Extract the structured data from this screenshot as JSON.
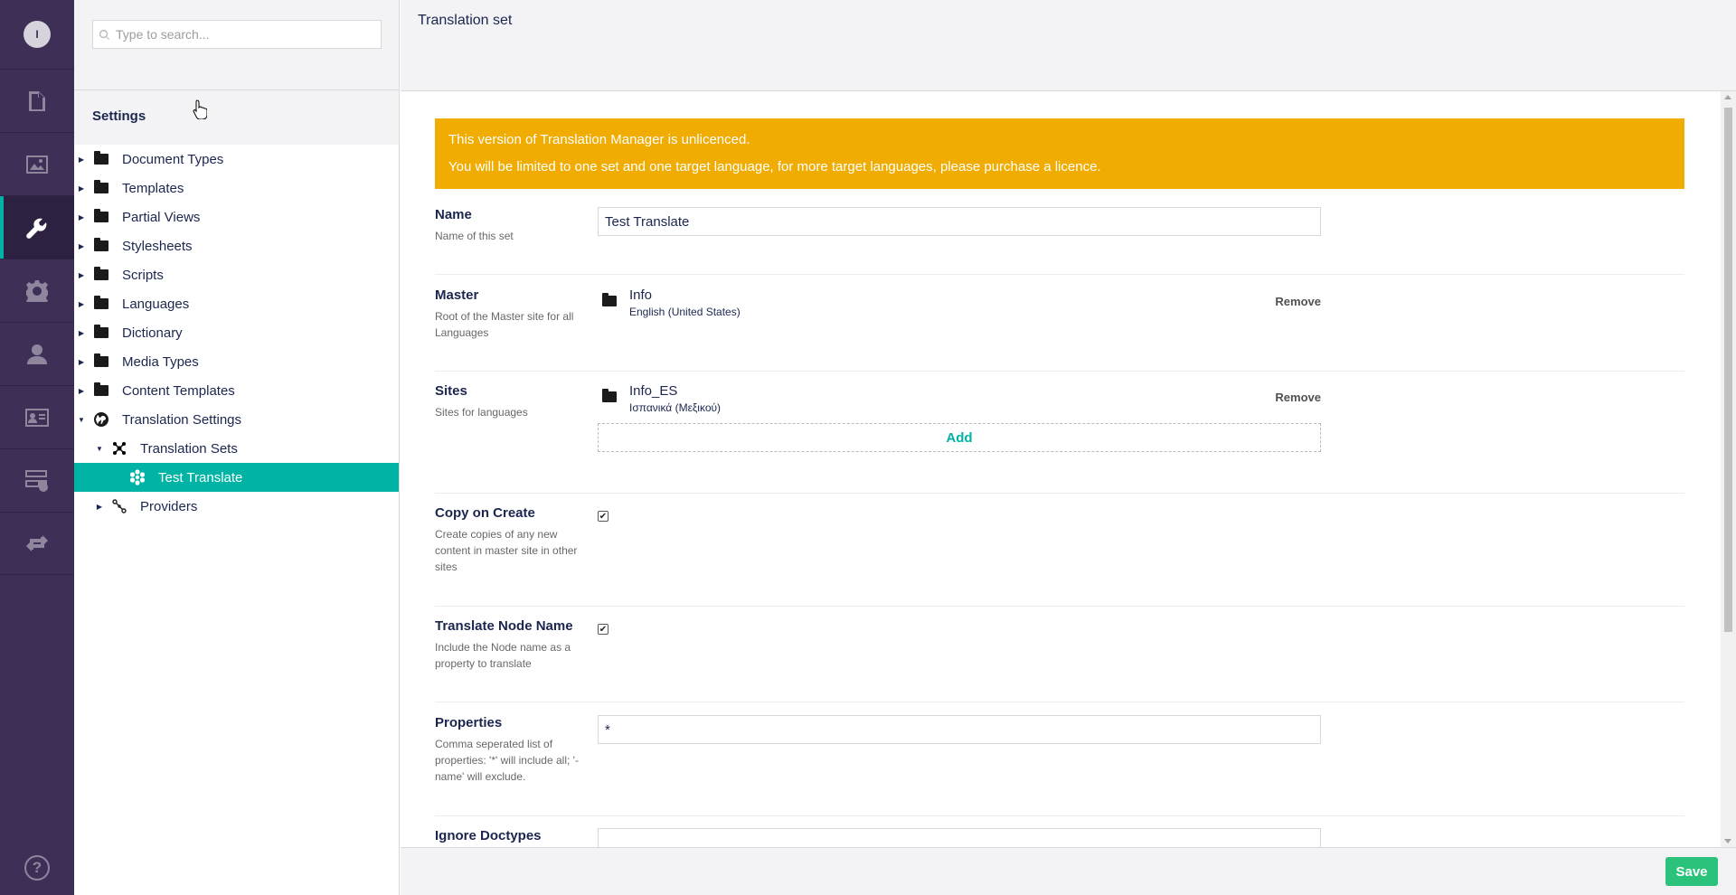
{
  "user": {
    "initial": "I"
  },
  "sections": [
    "content-icon",
    "media-icon",
    "settings-wrench-icon",
    "packages-gear-icon",
    "users-icon",
    "members-icon",
    "forms-icon",
    "translation-icon"
  ],
  "help_label": "?",
  "search": {
    "placeholder": "Type to search..."
  },
  "tree": {
    "title": "Settings",
    "items": [
      {
        "label": "Document Types",
        "icon": "folder-icon"
      },
      {
        "label": "Templates",
        "icon": "folder-icon"
      },
      {
        "label": "Partial Views",
        "icon": "folder-icon"
      },
      {
        "label": "Stylesheets",
        "icon": "folder-icon"
      },
      {
        "label": "Scripts",
        "icon": "folder-icon"
      },
      {
        "label": "Languages",
        "icon": "folder-icon"
      },
      {
        "label": "Dictionary",
        "icon": "folder-icon"
      },
      {
        "label": "Media Types",
        "icon": "folder-icon"
      },
      {
        "label": "Content Templates",
        "icon": "folder-icon"
      },
      {
        "label": "Translation Settings",
        "icon": "globe-icon"
      },
      {
        "label": "Translation Sets",
        "icon": "nodes-icon"
      },
      {
        "label": "Test Translate",
        "icon": "flower-icon"
      },
      {
        "label": "Providers",
        "icon": "link-icon"
      }
    ]
  },
  "editor": {
    "title": "Translation set",
    "notice": {
      "line1": "This version of Translation Manager is unlicenced.",
      "line2": "You will be limited to one set and one target language, for more target languages, please purchase a licence."
    },
    "name": {
      "label": "Name",
      "description": "Name of this set",
      "value": "Test Translate"
    },
    "master": {
      "label": "Master",
      "description": "Root of the Master site for all Languages",
      "node": "Info",
      "culture": "English (United States)",
      "remove": "Remove"
    },
    "sites": {
      "label": "Sites",
      "description": "Sites for languages",
      "node": "Info_ES",
      "culture": "Ισπανικά (Μεξικού)",
      "remove": "Remove",
      "add": "Add"
    },
    "copy_on_create": {
      "label": "Copy on Create",
      "description": "Create copies of any new content in master site in other sites",
      "checked": true
    },
    "translate_node_name": {
      "label": "Translate Node Name",
      "description": "Include the Node name as a property to translate",
      "checked": true
    },
    "properties": {
      "label": "Properties",
      "description": "Comma seperated list of properties: '*' will include all; '-name' will exclude.",
      "value": "*"
    },
    "ignore_doctypes": {
      "label": "Ignore Doctypes",
      "value": ""
    }
  },
  "footer": {
    "save": "Save"
  },
  "colors": {
    "rail": "#3e2f57",
    "accent": "#00b3a4",
    "notice": "#f0ac00",
    "save": "#2bc37c"
  }
}
